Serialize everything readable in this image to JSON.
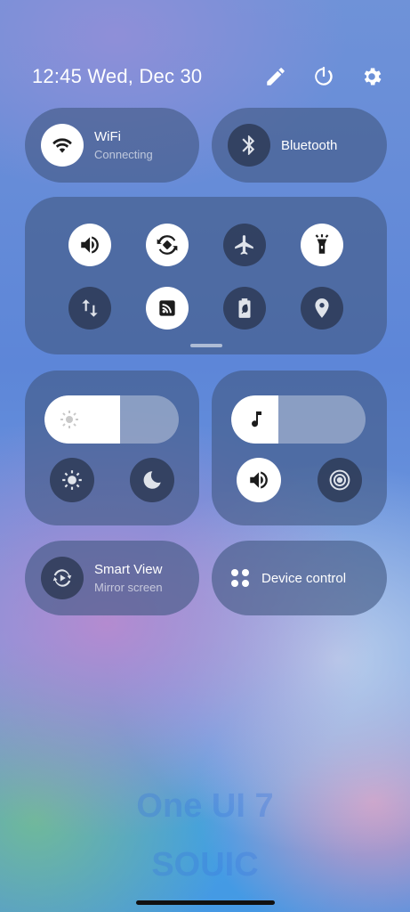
{
  "status": {
    "datetime": "12:45 Wed, Dec 30",
    "icons": [
      "edit-icon",
      "power-icon",
      "settings-icon"
    ]
  },
  "wifi": {
    "title": "WiFi",
    "subtitle": "Connecting",
    "state": "on"
  },
  "bluetooth": {
    "title": "Bluetooth",
    "state": "off"
  },
  "toggles": [
    {
      "icon": "sound-icon",
      "state": "on"
    },
    {
      "icon": "auto-rotate-icon",
      "state": "on"
    },
    {
      "icon": "airplane-mode-icon",
      "state": "off"
    },
    {
      "icon": "flashlight-icon",
      "state": "on"
    },
    {
      "icon": "mobile-data-icon",
      "state": "off"
    },
    {
      "icon": "nfc-icon",
      "state": "on"
    },
    {
      "icon": "power-saving-icon",
      "state": "off"
    },
    {
      "icon": "location-icon",
      "state": "off"
    }
  ],
  "brightness": {
    "level": 0.56,
    "icons": [
      "eye-comfort-icon",
      "dark-mode-icon"
    ]
  },
  "media_volume": {
    "level": 0.35,
    "icons": [
      "sound-mode-icon",
      "vibrate-icon"
    ]
  },
  "smart_view": {
    "title": "Smart View",
    "subtitle": "Mirror screen"
  },
  "device_control": {
    "title": "Device control"
  },
  "watermark": {
    "line1": "One UI 7",
    "line2": "SOUIC"
  },
  "colors": {
    "tile": "#42588299",
    "active": "#ffffff",
    "inactive": "#2a3650"
  }
}
